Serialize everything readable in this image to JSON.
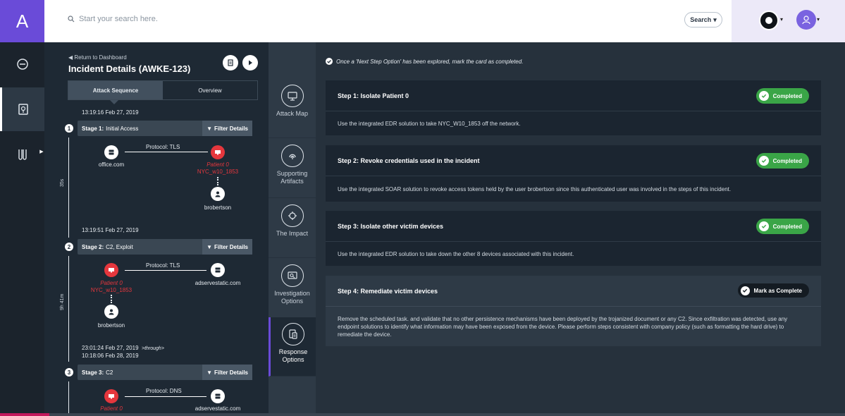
{
  "app": {
    "logo": "A",
    "search_placeholder": "Start your search here.",
    "search_button": "Search"
  },
  "incident": {
    "back_link": "Return to Dashboard",
    "title": "Incident Details (AWKE-123)",
    "tabs": [
      "Attack Sequence",
      "Overview"
    ],
    "filter_label": "Filter Details",
    "stages": [
      {
        "num": "1",
        "prefix": "Stage 1:",
        "name": "Initial Access",
        "timestamp": "13:19:16 Feb 27, 2019",
        "duration": "35s",
        "protocol": "Protocol: TLS",
        "source": "office.com",
        "patient_label": "Patient 0",
        "patient_host": "NYC_w10_1853",
        "user": "brobertson"
      },
      {
        "num": "2",
        "prefix": "Stage 2:",
        "name": "C2, Exploit",
        "timestamp": "13:19:51 Feb 27, 2019",
        "duration": "9h 41m",
        "protocol": "Protocol: TLS",
        "patient_label": "Patient 0",
        "patient_host": "NYC_w10_1853",
        "target": "adservestatic.com",
        "user": "brobertson"
      },
      {
        "num": "3",
        "prefix": "Stage 3:",
        "name": "C2",
        "timestamp": "23:01:24 Feb 27, 2019",
        "through": "through",
        "timestamp_end": "10:18:06 Feb 28, 2019",
        "protocol": "Protocol: DNS",
        "patient_label": "Patient 0",
        "target": "adservestatic.com"
      }
    ]
  },
  "options": [
    {
      "label": "Attack Map",
      "icon": "monitor-icon"
    },
    {
      "label": "Supporting Artifacts",
      "icon": "fingerprint-icon"
    },
    {
      "label": "The Impact",
      "icon": "impact-icon"
    },
    {
      "label": "Investigation Options",
      "icon": "investigation-icon"
    },
    {
      "label": "Response Options",
      "icon": "response-icon",
      "active": true
    }
  ],
  "main": {
    "instruction": "Once a 'Next Step Option' has been explored, mark the card as completed.",
    "completed_label": "Completed",
    "mark_label": "Mark as Complete",
    "steps": [
      {
        "title": "Step 1: Isolate Patient 0",
        "body": "Use the integrated EDR solution to take NYC_W10_1853 off the network.",
        "status": "completed"
      },
      {
        "title": "Step 2: Revoke credentials used in the incident",
        "body": "Use the integrated SOAR solution to revoke access tokens held by the user brobertson since this authenticated user was involved in the steps of this incident.",
        "status": "completed"
      },
      {
        "title": "Step 3: Isolate other victim devices",
        "body": "Use the integrated EDR solution to take down the other 8 devices associated with this incident.",
        "status": "completed"
      },
      {
        "title": "Step 4: Remediate victim devices",
        "body": "Remove the scheduled task. and validate that no other persistence mechanisms have been deployed by the trojanized document or any C2. Since exfiltration was detected, use any endpoint solutions to identify what information may have been exposed from the device. Please perform steps consistent with company policy (such as formatting the hard drive) to remediate the device.",
        "status": "open"
      }
    ]
  },
  "colors": {
    "brand": "#6a4bd8",
    "completed": "#3aa547",
    "patient": "#e5373d"
  }
}
